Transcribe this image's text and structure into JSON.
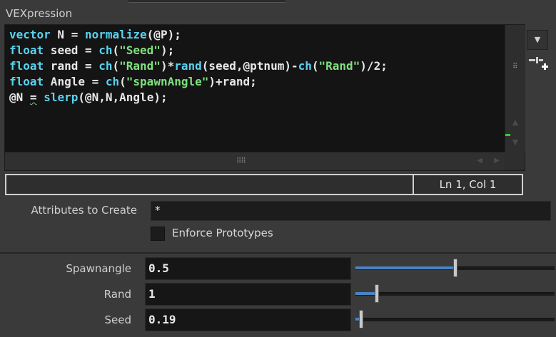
{
  "section": {
    "title": "VEXpression"
  },
  "editor": {
    "lines": [
      [
        {
          "text": "vector",
          "cls": "t-kw"
        },
        {
          "text": " N = ",
          "cls": ""
        },
        {
          "text": "normalize",
          "cls": "t-fn"
        },
        {
          "text": "(@P);",
          "cls": ""
        }
      ],
      [
        {
          "text": "float",
          "cls": "t-kw"
        },
        {
          "text": " seed = ",
          "cls": ""
        },
        {
          "text": "ch",
          "cls": "t-fn"
        },
        {
          "text": "(",
          "cls": ""
        },
        {
          "text": "\"Seed\"",
          "cls": "t-str"
        },
        {
          "text": ");",
          "cls": ""
        }
      ],
      [
        {
          "text": "float",
          "cls": "t-kw"
        },
        {
          "text": " rand = ",
          "cls": ""
        },
        {
          "text": "ch",
          "cls": "t-fn"
        },
        {
          "text": "(",
          "cls": ""
        },
        {
          "text": "\"Rand\"",
          "cls": "t-str"
        },
        {
          "text": ")*",
          "cls": ""
        },
        {
          "text": "rand",
          "cls": "t-fn"
        },
        {
          "text": "(seed,@ptnum)-",
          "cls": ""
        },
        {
          "text": "ch",
          "cls": "t-fn"
        },
        {
          "text": "(",
          "cls": ""
        },
        {
          "text": "\"Rand\"",
          "cls": "t-str"
        },
        {
          "text": ")/2;",
          "cls": ""
        }
      ],
      [
        {
          "text": "float",
          "cls": "t-kw"
        },
        {
          "text": " Angle = ",
          "cls": ""
        },
        {
          "text": "ch",
          "cls": "t-fn"
        },
        {
          "text": "(",
          "cls": ""
        },
        {
          "text": "\"spawnAngle\"",
          "cls": "t-str"
        },
        {
          "text": ")+rand;",
          "cls": ""
        }
      ],
      [
        {
          "text": "@N ",
          "cls": ""
        },
        {
          "text": "=",
          "cls": "t-squig"
        },
        {
          "text": " ",
          "cls": ""
        },
        {
          "text": "slerp",
          "cls": "t-fn"
        },
        {
          "text": "(@N,N,Angle);",
          "cls": ""
        }
      ]
    ],
    "status_position": "Ln 1, Col 1"
  },
  "attributes": {
    "label": "Attributes to Create",
    "value": "*"
  },
  "enforce": {
    "label": "Enforce Prototypes",
    "checked": false
  },
  "params": [
    {
      "label": "Spawnangle",
      "value": "0.5",
      "fraction": 0.5
    },
    {
      "label": "Rand",
      "value": "1",
      "fraction": 0.1
    },
    {
      "label": "Seed",
      "value": "0.19",
      "fraction": 0.019
    }
  ],
  "icons": {
    "dropdown": "chevron-down-icon",
    "add_spare": "add-parameter-icon",
    "grip": "grip-icon"
  },
  "colors": {
    "keyword": "#5ad2f0",
    "string": "#7fe07f",
    "slider_fill": "#4a84c4",
    "scroll_marker": "#2fd12f"
  }
}
